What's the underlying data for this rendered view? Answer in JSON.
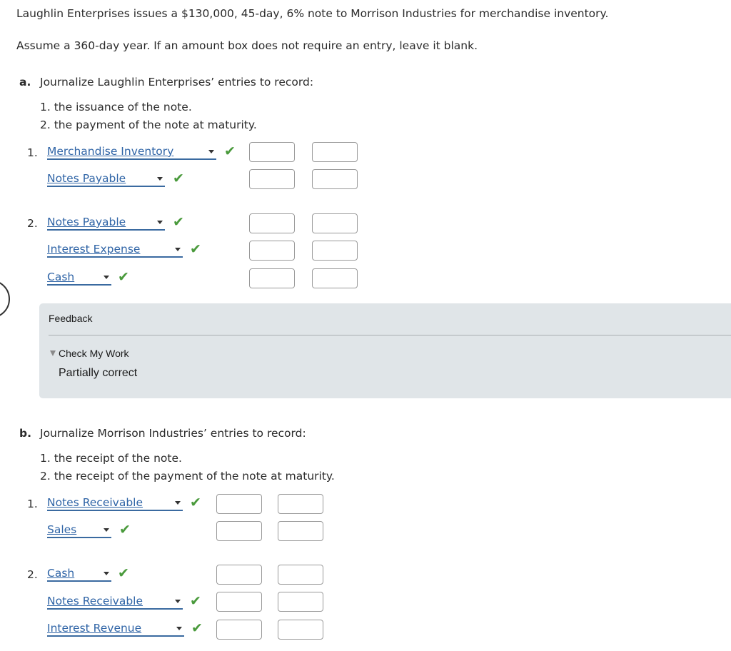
{
  "intro": {
    "line1": "Laughlin Enterprises issues a $130,000, 45-day, 6% note to Morrison Industries for merchandise inventory.",
    "line2": "Assume a 360-day year. If an amount box does not require an entry, leave it blank."
  },
  "part_a": {
    "letter": "a.",
    "instruction": "Journalize Laughlin Enterprises’ entries to record:",
    "items": [
      "1. the issuance of the note.",
      "2. the payment of the note at maturity."
    ],
    "entries": [
      {
        "number": "1.",
        "lines": [
          {
            "account": "Merchandise Inventory",
            "status": "correct",
            "debit": "",
            "credit": ""
          },
          {
            "account": "Notes Payable",
            "status": "correct",
            "debit": "",
            "credit": ""
          }
        ]
      },
      {
        "number": "2.",
        "lines": [
          {
            "account": "Notes Payable",
            "status": "correct",
            "debit": "",
            "credit": ""
          },
          {
            "account": "Interest Expense",
            "status": "correct",
            "debit": "",
            "credit": ""
          },
          {
            "account": "Cash",
            "status": "correct",
            "debit": "",
            "credit": ""
          }
        ]
      }
    ]
  },
  "feedback": {
    "title": "Feedback",
    "toggle_label": "Check My Work",
    "result": "Partially correct"
  },
  "part_b": {
    "letter": "b.",
    "instruction": "Journalize Morrison Industries’ entries to record:",
    "items": [
      "1. the receipt of the note.",
      "2. the receipt of the payment of the note at maturity."
    ],
    "entries": [
      {
        "number": "1.",
        "lines": [
          {
            "account": "Notes Receivable",
            "status": "correct",
            "debit": "",
            "credit": ""
          },
          {
            "account": "Sales",
            "status": "correct",
            "debit": "",
            "credit": ""
          }
        ]
      },
      {
        "number": "2.",
        "lines": [
          {
            "account": "Cash",
            "status": "correct",
            "debit": "",
            "credit": ""
          },
          {
            "account": "Notes Receivable",
            "status": "correct",
            "debit": "",
            "credit": ""
          },
          {
            "account": "Interest Revenue",
            "status": "correct",
            "debit": "",
            "credit": ""
          }
        ]
      }
    ]
  },
  "icons": {
    "check": "✔",
    "caret": "caret-down-icon"
  },
  "colors": {
    "link": "#2f64a6",
    "check": "#4a9a3c",
    "feedback_bg": "#e0e5e8"
  }
}
